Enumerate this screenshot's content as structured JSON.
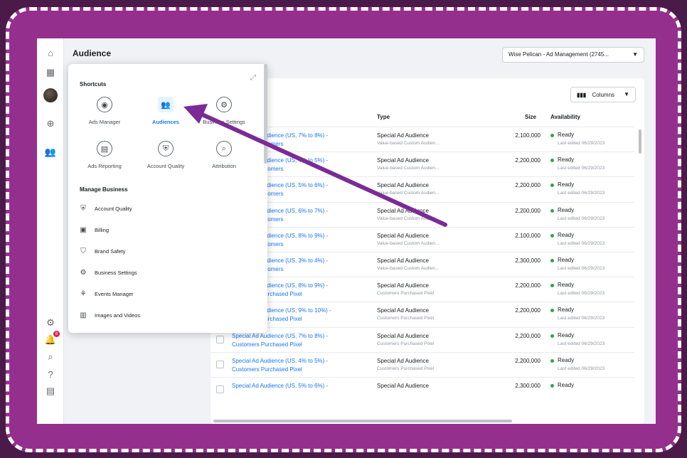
{
  "colors": {
    "frame": "#952f8d",
    "arrow": "#7a2b95",
    "accent": "#1877f2",
    "ready": "#31a24c"
  },
  "header": {
    "title": "Audience",
    "account": "Wise Pelican - Ad Management (2745..."
  },
  "rail": {
    "icons": [
      "home-icon",
      "apps-grid-icon",
      "avatar",
      "add-circle-icon",
      "audiences-icon",
      "settings-icon",
      "notifications-icon",
      "search-icon",
      "help-icon",
      "reports-icon"
    ],
    "notification_count": "8"
  },
  "table": {
    "columns_label": "Columns",
    "headers": {
      "type": "Type",
      "size": "Size",
      "availability": "Availability"
    },
    "rows": [
      {
        "name1": "Special Ad Audience (US, 7% to 8%) -",
        "name2": "VolunteerCustomers",
        "type1": "Special Ad Audience",
        "type2": "Value-based Custom Audien...",
        "size": "2,100,000",
        "avail": "Ready",
        "edited": "Last edited 06/29/2023"
      },
      {
        "name1": "Special Ad Audience (US, 4% to 5%) -",
        "name2": "VolunteerCustomers",
        "type1": "Special Ad Audience",
        "type2": "Value-based Custom Audien...",
        "size": "2,200,000",
        "avail": "Ready",
        "edited": "Last edited 06/29/2023"
      },
      {
        "name1": "Special Ad Audience (US, 5% to 6%) -",
        "name2": "VolunteerCustomers",
        "type1": "Special Ad Audience",
        "type2": "Value-based Custom Audien...",
        "size": "2,200,000",
        "avail": "Ready",
        "edited": "Last edited 06/29/2023"
      },
      {
        "name1": "Special Ad Audience (US, 6% to 7%) -",
        "name2": "VolunteerCustomers",
        "type1": "Special Ad Audience",
        "type2": "Value-based Custom Audien...",
        "size": "2,200,000",
        "avail": "Ready",
        "edited": "Last edited 06/29/2023"
      },
      {
        "name1": "Special Ad Audience (US, 8% to 9%) -",
        "name2": "VolunteerCustomers",
        "type1": "Special Ad Audience",
        "type2": "Value-based Custom Audien...",
        "size": "2,100,000",
        "avail": "Ready",
        "edited": "Last edited 06/29/2023"
      },
      {
        "name1": "Special Ad Audience (US, 3% to 4%) -",
        "name2": "VolunteerCustomers",
        "type1": "Special Ad Audience",
        "type2": "Value-based Custom Audien...",
        "size": "2,300,000",
        "avail": "Ready",
        "edited": "Last edited 06/29/2023"
      },
      {
        "name1": "Special Ad Audience (US, 8% to 9%) -",
        "name2": "Customers Purchased Pixel",
        "type1": "Special Ad Audience",
        "type2": "Customers Purchased Pixel",
        "size": "2,200,000",
        "avail": "Ready",
        "edited": "Last edited 06/29/2023"
      },
      {
        "name1": "Special Ad Audience (US, 9% to 10%) -",
        "name2": "Customers Purchased Pixel",
        "type1": "Special Ad Audience",
        "type2": "Customers Purchased Pixel",
        "size": "2,200,000",
        "avail": "Ready",
        "edited": "Last edited 06/29/2023"
      },
      {
        "name1": "Special Ad Audience (US, 7% to 8%) -",
        "name2": "Customers Purchased Pixel",
        "type1": "Special Ad Audience",
        "type2": "Customers Purchased Pixel",
        "size": "2,200,000",
        "avail": "Ready",
        "edited": "Last edited 06/29/2023"
      },
      {
        "name1": "Special Ad Audience (US, 4% to 5%) -",
        "name2": "Customers Purchased Pixel",
        "type1": "Special Ad Audience",
        "type2": "Customers Purchased Pixel",
        "size": "2,200,000",
        "avail": "Ready",
        "edited": "Last edited 06/29/2023"
      },
      {
        "name1": "Special Ad Audience (US, 5% to 6%) -",
        "name2": "",
        "type1": "Special Ad Audience",
        "type2": "",
        "size": "2,300,000",
        "avail": "Ready",
        "edited": ""
      }
    ]
  },
  "menu": {
    "shortcuts_title": "Shortcuts",
    "shortcuts": [
      {
        "label": "Ads Manager",
        "icon": "ads-manager-icon",
        "active": false
      },
      {
        "label": "Audiences",
        "icon": "audiences-icon",
        "active": true
      },
      {
        "label": "Business Settings",
        "icon": "gear-icon",
        "active": false
      },
      {
        "label": "Ads Reporting",
        "icon": "ads-reporting-icon",
        "active": false
      },
      {
        "label": "Account Quality",
        "icon": "shield-icon",
        "active": false
      },
      {
        "label": "Attribution",
        "icon": "attribution-icon",
        "active": false
      }
    ],
    "manage_title": "Manage Business",
    "manage_items": [
      {
        "label": "Account Quality",
        "icon": "shield-icon"
      },
      {
        "label": "Billing",
        "icon": "billing-icon"
      },
      {
        "label": "Brand Safety",
        "icon": "brand-safety-icon"
      },
      {
        "label": "Business Settings",
        "icon": "gear-icon"
      },
      {
        "label": "Events Manager",
        "icon": "events-manager-icon"
      },
      {
        "label": "Images and Videos",
        "icon": "images-videos-icon"
      }
    ]
  }
}
